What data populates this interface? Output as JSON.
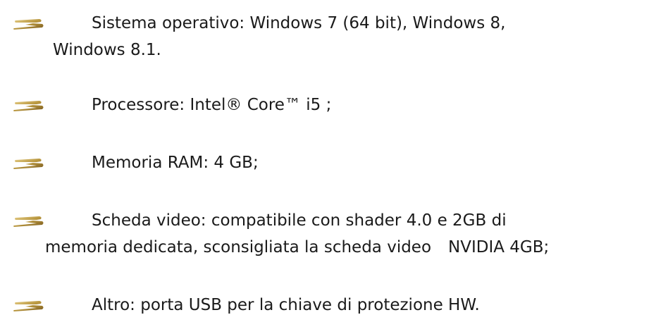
{
  "bullet_icon": "gold-swoosh-icon",
  "bullet_color": "#b8963e",
  "items": [
    {
      "line1": "Sistema operativo: Windows 7 (64 bit), Windows 8,",
      "line2": "Windows 8.1."
    },
    {
      "line1": "Processore: Intel® Core™ i5 ;"
    },
    {
      "line1": "Memoria RAM: 4 GB;"
    },
    {
      "line1": "Scheda video: compatibile con shader 4.0 e 2GB di",
      "line2_a": "memoria dedicata, sconsigliata la scheda video",
      "line2_b": "NVIDIA 4GB;"
    },
    {
      "line1": "Altro: porta USB per la chiave di protezione HW."
    }
  ]
}
